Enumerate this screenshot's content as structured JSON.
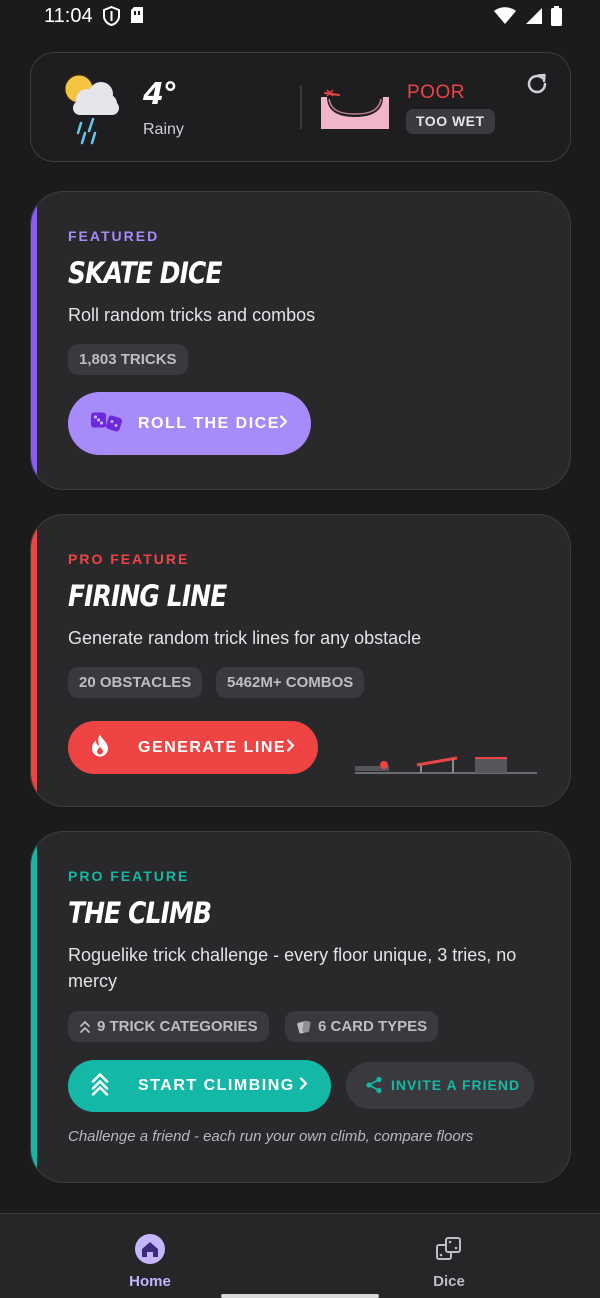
{
  "status_bar": {
    "time": "11:04"
  },
  "weather": {
    "temperature": "4°",
    "condition": "Rainy",
    "quality": "POOR",
    "reason": "TOO WET"
  },
  "skate_dice": {
    "eyebrow": "FEATURED",
    "title": "SKATE DICE",
    "description": "Roll random tricks and combos",
    "chip_tricks": "1,803 TRICKS",
    "button_label": "ROLL THE DICE",
    "accent_color": "#8b5cf6",
    "button_color": "#a78bfa"
  },
  "firing_line": {
    "eyebrow": "PRO FEATURE",
    "title": "FIRING LINE",
    "description": "Generate random trick lines for any obstacle",
    "chip_obstacles": "20 OBSTACLES",
    "chip_combos": "5462M+ COMBOS",
    "button_label": "GENERATE LINE",
    "accent_color": "#ef4444"
  },
  "the_climb": {
    "eyebrow": "PRO FEATURE",
    "title": "THE CLIMB",
    "description": "Roguelike trick challenge - every floor unique, 3 tries, no mercy",
    "chip_categories": "9 TRICK CATEGORIES",
    "chip_cards": "6 CARD TYPES",
    "button_label": "START CLIMBING",
    "invite_label": "INVITE A FRIEND",
    "footnote": "Challenge a friend - each run your own climb, compare floors",
    "accent_color": "#14b8a6"
  },
  "nav": {
    "home_label": "Home",
    "dice_label": "Dice",
    "active_color": "#c4b5fd"
  }
}
